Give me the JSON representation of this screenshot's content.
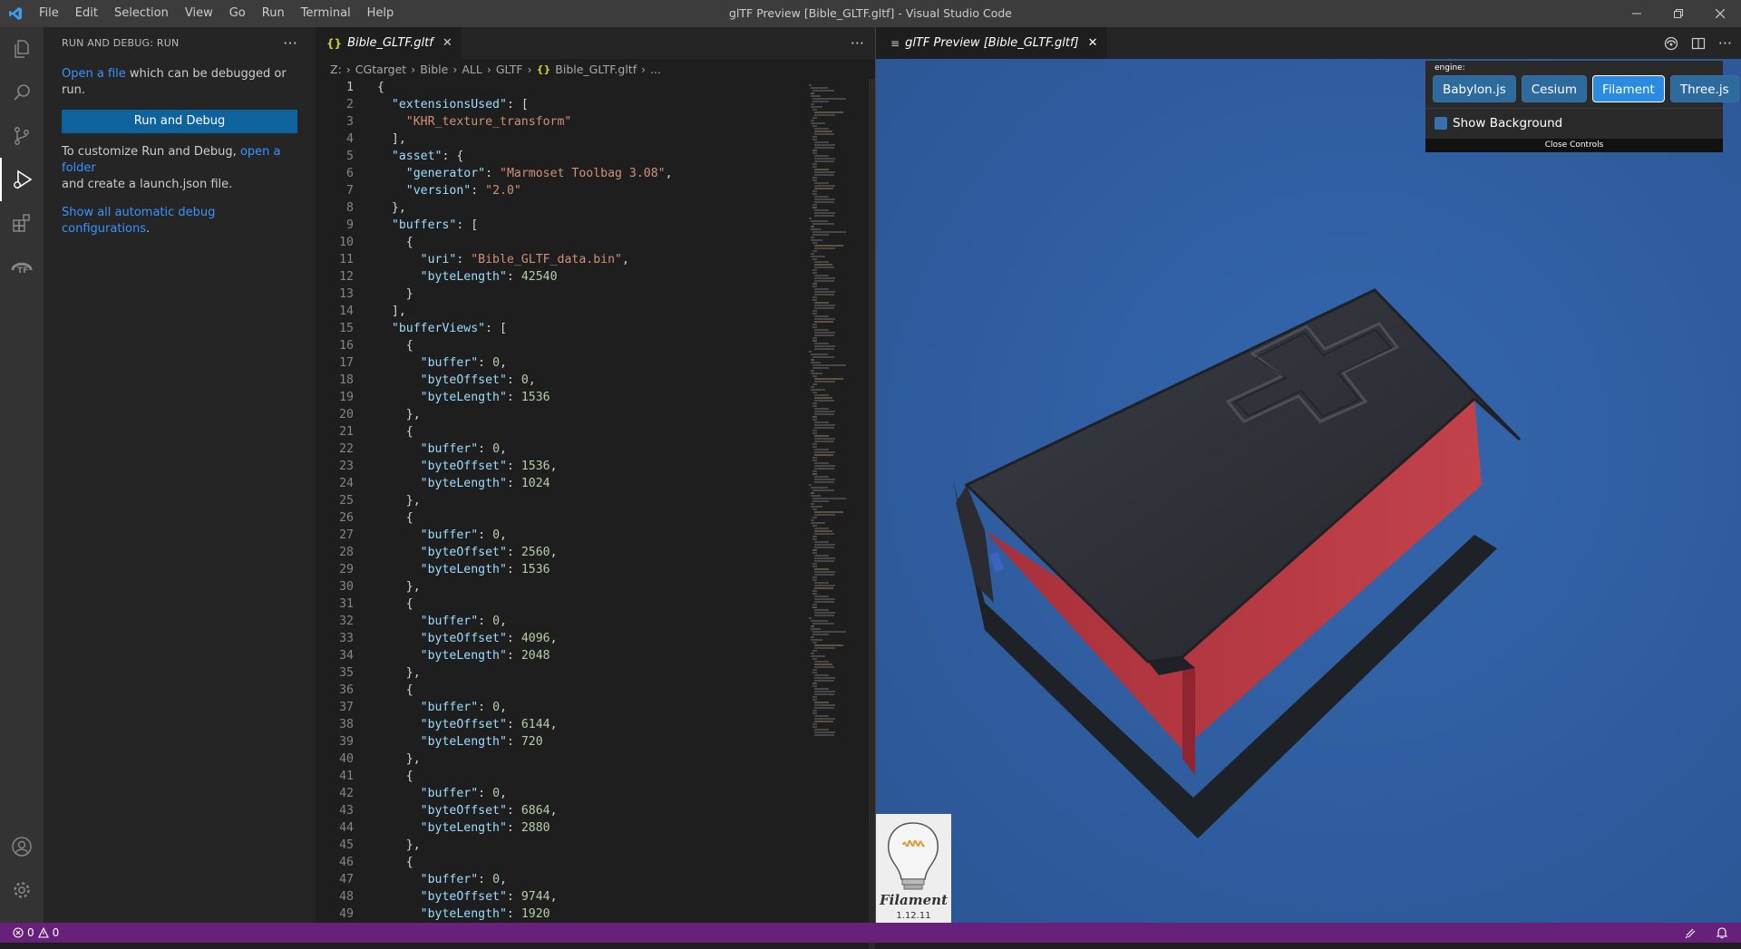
{
  "window": {
    "title": "glTF Preview [Bible_GLTF.gltf] - Visual Studio Code",
    "menu": [
      "File",
      "Edit",
      "Selection",
      "View",
      "Go",
      "Run",
      "Terminal",
      "Help"
    ]
  },
  "activity_bar": {
    "items": [
      "explorer-icon",
      "search-icon",
      "source-control-icon",
      "run-debug-icon",
      "extensions-icon",
      "gltf-icon"
    ],
    "bottom": [
      "account-icon",
      "settings-gear-icon"
    ]
  },
  "sidebar": {
    "title": "RUN AND DEBUG: RUN",
    "open_file_link": "Open a file",
    "open_file_rest": " which can be debugged or run.",
    "run_button": "Run and Debug",
    "customize_text": "To customize Run and Debug, ",
    "open_folder_link": "open a folder",
    "customize_rest": "and create a launch.json file.",
    "show_all_link": "Show all automatic debug configurations",
    "show_all_end": "."
  },
  "editor": {
    "tab_label": "Bible_GLTF.gltf",
    "tab_icon": "{}",
    "breadcrumbs": [
      "Z:",
      "CGtarget",
      "Bible",
      "ALL",
      "GLTF",
      "Bible_GLTF.gltf",
      "..."
    ],
    "lines": [
      [
        [
          "p",
          "{"
        ]
      ],
      [
        [
          "p",
          "  "
        ],
        [
          "k",
          "\"extensionsUsed\""
        ],
        [
          "p",
          ": ["
        ]
      ],
      [
        [
          "p",
          "    "
        ],
        [
          "s",
          "\"KHR_texture_transform\""
        ]
      ],
      [
        [
          "p",
          "  ],"
        ]
      ],
      [
        [
          "p",
          "  "
        ],
        [
          "k",
          "\"asset\""
        ],
        [
          "p",
          ": {"
        ]
      ],
      [
        [
          "p",
          "    "
        ],
        [
          "k",
          "\"generator\""
        ],
        [
          "p",
          ": "
        ],
        [
          "s",
          "\"Marmoset Toolbag 3.08\""
        ],
        [
          "p",
          ","
        ]
      ],
      [
        [
          "p",
          "    "
        ],
        [
          "k",
          "\"version\""
        ],
        [
          "p",
          ": "
        ],
        [
          "s",
          "\"2.0\""
        ]
      ],
      [
        [
          "p",
          "  },"
        ]
      ],
      [
        [
          "p",
          "  "
        ],
        [
          "k",
          "\"buffers\""
        ],
        [
          "p",
          ": ["
        ]
      ],
      [
        [
          "p",
          "    {"
        ]
      ],
      [
        [
          "p",
          "      "
        ],
        [
          "k",
          "\"uri\""
        ],
        [
          "p",
          ": "
        ],
        [
          "s",
          "\"Bible_GLTF_data.bin\""
        ],
        [
          "p",
          ","
        ]
      ],
      [
        [
          "p",
          "      "
        ],
        [
          "k",
          "\"byteLength\""
        ],
        [
          "p",
          ": "
        ],
        [
          "n",
          "42540"
        ]
      ],
      [
        [
          "p",
          "    }"
        ]
      ],
      [
        [
          "p",
          "  ],"
        ]
      ],
      [
        [
          "p",
          "  "
        ],
        [
          "k",
          "\"bufferViews\""
        ],
        [
          "p",
          ": ["
        ]
      ],
      [
        [
          "p",
          "    {"
        ]
      ],
      [
        [
          "p",
          "      "
        ],
        [
          "k",
          "\"buffer\""
        ],
        [
          "p",
          ": "
        ],
        [
          "n",
          "0"
        ],
        [
          "p",
          ","
        ]
      ],
      [
        [
          "p",
          "      "
        ],
        [
          "k",
          "\"byteOffset\""
        ],
        [
          "p",
          ": "
        ],
        [
          "n",
          "0"
        ],
        [
          "p",
          ","
        ]
      ],
      [
        [
          "p",
          "      "
        ],
        [
          "k",
          "\"byteLength\""
        ],
        [
          "p",
          ": "
        ],
        [
          "n",
          "1536"
        ]
      ],
      [
        [
          "p",
          "    },"
        ]
      ],
      [
        [
          "p",
          "    {"
        ]
      ],
      [
        [
          "p",
          "      "
        ],
        [
          "k",
          "\"buffer\""
        ],
        [
          "p",
          ": "
        ],
        [
          "n",
          "0"
        ],
        [
          "p",
          ","
        ]
      ],
      [
        [
          "p",
          "      "
        ],
        [
          "k",
          "\"byteOffset\""
        ],
        [
          "p",
          ": "
        ],
        [
          "n",
          "1536"
        ],
        [
          "p",
          ","
        ]
      ],
      [
        [
          "p",
          "      "
        ],
        [
          "k",
          "\"byteLength\""
        ],
        [
          "p",
          ": "
        ],
        [
          "n",
          "1024"
        ]
      ],
      [
        [
          "p",
          "    },"
        ]
      ],
      [
        [
          "p",
          "    {"
        ]
      ],
      [
        [
          "p",
          "      "
        ],
        [
          "k",
          "\"buffer\""
        ],
        [
          "p",
          ": "
        ],
        [
          "n",
          "0"
        ],
        [
          "p",
          ","
        ]
      ],
      [
        [
          "p",
          "      "
        ],
        [
          "k",
          "\"byteOffset\""
        ],
        [
          "p",
          ": "
        ],
        [
          "n",
          "2560"
        ],
        [
          "p",
          ","
        ]
      ],
      [
        [
          "p",
          "      "
        ],
        [
          "k",
          "\"byteLength\""
        ],
        [
          "p",
          ": "
        ],
        [
          "n",
          "1536"
        ]
      ],
      [
        [
          "p",
          "    },"
        ]
      ],
      [
        [
          "p",
          "    {"
        ]
      ],
      [
        [
          "p",
          "      "
        ],
        [
          "k",
          "\"buffer\""
        ],
        [
          "p",
          ": "
        ],
        [
          "n",
          "0"
        ],
        [
          "p",
          ","
        ]
      ],
      [
        [
          "p",
          "      "
        ],
        [
          "k",
          "\"byteOffset\""
        ],
        [
          "p",
          ": "
        ],
        [
          "n",
          "4096"
        ],
        [
          "p",
          ","
        ]
      ],
      [
        [
          "p",
          "      "
        ],
        [
          "k",
          "\"byteLength\""
        ],
        [
          "p",
          ": "
        ],
        [
          "n",
          "2048"
        ]
      ],
      [
        [
          "p",
          "    },"
        ]
      ],
      [
        [
          "p",
          "    {"
        ]
      ],
      [
        [
          "p",
          "      "
        ],
        [
          "k",
          "\"buffer\""
        ],
        [
          "p",
          ": "
        ],
        [
          "n",
          "0"
        ],
        [
          "p",
          ","
        ]
      ],
      [
        [
          "p",
          "      "
        ],
        [
          "k",
          "\"byteOffset\""
        ],
        [
          "p",
          ": "
        ],
        [
          "n",
          "6144"
        ],
        [
          "p",
          ","
        ]
      ],
      [
        [
          "p",
          "      "
        ],
        [
          "k",
          "\"byteLength\""
        ],
        [
          "p",
          ": "
        ],
        [
          "n",
          "720"
        ]
      ],
      [
        [
          "p",
          "    },"
        ]
      ],
      [
        [
          "p",
          "    {"
        ]
      ],
      [
        [
          "p",
          "      "
        ],
        [
          "k",
          "\"buffer\""
        ],
        [
          "p",
          ": "
        ],
        [
          "n",
          "0"
        ],
        [
          "p",
          ","
        ]
      ],
      [
        [
          "p",
          "      "
        ],
        [
          "k",
          "\"byteOffset\""
        ],
        [
          "p",
          ": "
        ],
        [
          "n",
          "6864"
        ],
        [
          "p",
          ","
        ]
      ],
      [
        [
          "p",
          "      "
        ],
        [
          "k",
          "\"byteLength\""
        ],
        [
          "p",
          ": "
        ],
        [
          "n",
          "2880"
        ]
      ],
      [
        [
          "p",
          "    },"
        ]
      ],
      [
        [
          "p",
          "    {"
        ]
      ],
      [
        [
          "p",
          "      "
        ],
        [
          "k",
          "\"buffer\""
        ],
        [
          "p",
          ": "
        ],
        [
          "n",
          "0"
        ],
        [
          "p",
          ","
        ]
      ],
      [
        [
          "p",
          "      "
        ],
        [
          "k",
          "\"byteOffset\""
        ],
        [
          "p",
          ": "
        ],
        [
          "n",
          "9744"
        ],
        [
          "p",
          ","
        ]
      ],
      [
        [
          "p",
          "      "
        ],
        [
          "k",
          "\"byteLength\""
        ],
        [
          "p",
          ": "
        ],
        [
          "n",
          "1920"
        ]
      ]
    ]
  },
  "preview": {
    "tab_label": "glTF Preview [Bible_GLTF.gltf]",
    "engine_label": "engine:",
    "engines": [
      "Babylon.js",
      "Cesium",
      "Filament",
      "Three.js"
    ],
    "active_engine": "Filament",
    "show_background_label": "Show Background",
    "close_controls_label": "Close Controls",
    "logo_name": "Filament",
    "logo_version": "1.12.11"
  },
  "statusbar": {
    "errors": "0",
    "warnings": "0"
  },
  "colors": {
    "statusbar": "#68217a",
    "viewport": "#2f5c9f",
    "accent_button": "#0e639c"
  }
}
